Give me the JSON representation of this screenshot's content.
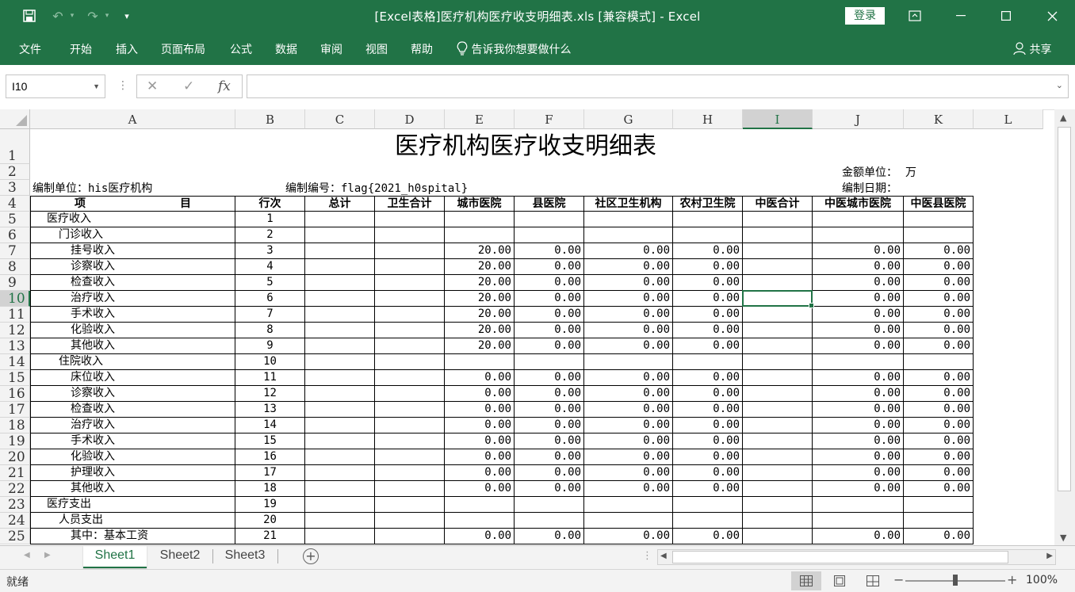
{
  "window": {
    "title": "[Excel表格]医疗机构医疗收支明细表.xls  [兼容模式]  -  Excel",
    "login_label": "登录",
    "minimize": "—",
    "restore": "☐",
    "close": "✕",
    "ribbon_toggle": "⊡"
  },
  "quick_access": {
    "save": "🖫",
    "undo": "↶",
    "redo": "↷",
    "customize": "▾"
  },
  "menu": {
    "items": [
      "文件",
      "开始",
      "插入",
      "页面布局",
      "公式",
      "数据",
      "审阅",
      "视图",
      "帮助"
    ],
    "tell_me": "告诉我你想要做什么",
    "share": "共享"
  },
  "formula_bar": {
    "name_box": "I10",
    "cancel": "✕",
    "enter": "✓",
    "fx": "fx",
    "formula": ""
  },
  "columns": [
    "A",
    "B",
    "C",
    "D",
    "E",
    "F",
    "G",
    "H",
    "I",
    "J",
    "K",
    "L"
  ],
  "selected_column": "I",
  "rows": [
    "1",
    "2",
    "3",
    "4",
    "5",
    "6",
    "7",
    "8",
    "9",
    "10",
    "11",
    "12",
    "13",
    "14",
    "15",
    "16",
    "17",
    "18",
    "19",
    "20",
    "21",
    "22",
    "23",
    "24",
    "25"
  ],
  "selected_row": "10",
  "sheet": {
    "title": "医疗机构医疗收支明细表",
    "amount_unit_label": "金额单位：",
    "amount_unit_value": "万",
    "unit_label": "编制单位：his医疗机构",
    "code_label": "编制编号：flag{2021_h0spital}",
    "date_label": "编制日期：",
    "header": {
      "item_left": "项",
      "item_right": "目",
      "row_no": "行次",
      "total": "总计",
      "health_total": "卫生合计",
      "city_hospital": "城市医院",
      "county_hospital": "县医院",
      "community": "社区卫生机构",
      "rural": "农村卫生院",
      "tcm_total": "中医合计",
      "tcm_city": "中医城市医院",
      "tcm_county": "中医县医院"
    },
    "data_rows": [
      {
        "item": "医疗收入",
        "indent": 1,
        "no": "1",
        "E": "",
        "F": "",
        "G": "",
        "H": "",
        "J": "",
        "K": ""
      },
      {
        "item": "门诊收入",
        "indent": 2,
        "no": "2",
        "E": "",
        "F": "",
        "G": "",
        "H": "",
        "J": "",
        "K": ""
      },
      {
        "item": "挂号收入",
        "indent": 3,
        "no": "3",
        "E": "20.00",
        "F": "0.00",
        "G": "0.00",
        "H": "0.00",
        "J": "0.00",
        "K": "0.00"
      },
      {
        "item": "诊察收入",
        "indent": 3,
        "no": "4",
        "E": "20.00",
        "F": "0.00",
        "G": "0.00",
        "H": "0.00",
        "J": "0.00",
        "K": "0.00"
      },
      {
        "item": "检查收入",
        "indent": 3,
        "no": "5",
        "E": "20.00",
        "F": "0.00",
        "G": "0.00",
        "H": "0.00",
        "J": "0.00",
        "K": "0.00"
      },
      {
        "item": "治疗收入",
        "indent": 3,
        "no": "6",
        "E": "20.00",
        "F": "0.00",
        "G": "0.00",
        "H": "0.00",
        "J": "0.00",
        "K": "0.00"
      },
      {
        "item": "手术收入",
        "indent": 3,
        "no": "7",
        "E": "20.00",
        "F": "0.00",
        "G": "0.00",
        "H": "0.00",
        "J": "0.00",
        "K": "0.00"
      },
      {
        "item": "化验收入",
        "indent": 3,
        "no": "8",
        "E": "20.00",
        "F": "0.00",
        "G": "0.00",
        "H": "0.00",
        "J": "0.00",
        "K": "0.00"
      },
      {
        "item": "其他收入",
        "indent": 3,
        "no": "9",
        "E": "20.00",
        "F": "0.00",
        "G": "0.00",
        "H": "0.00",
        "J": "0.00",
        "K": "0.00"
      },
      {
        "item": "住院收入",
        "indent": 2,
        "no": "10",
        "E": "",
        "F": "",
        "G": "",
        "H": "",
        "J": "",
        "K": ""
      },
      {
        "item": "床位收入",
        "indent": 3,
        "no": "11",
        "E": "0.00",
        "F": "0.00",
        "G": "0.00",
        "H": "0.00",
        "J": "0.00",
        "K": "0.00"
      },
      {
        "item": "诊察收入",
        "indent": 3,
        "no": "12",
        "E": "0.00",
        "F": "0.00",
        "G": "0.00",
        "H": "0.00",
        "J": "0.00",
        "K": "0.00"
      },
      {
        "item": "检查收入",
        "indent": 3,
        "no": "13",
        "E": "0.00",
        "F": "0.00",
        "G": "0.00",
        "H": "0.00",
        "J": "0.00",
        "K": "0.00"
      },
      {
        "item": "治疗收入",
        "indent": 3,
        "no": "14",
        "E": "0.00",
        "F": "0.00",
        "G": "0.00",
        "H": "0.00",
        "J": "0.00",
        "K": "0.00"
      },
      {
        "item": "手术收入",
        "indent": 3,
        "no": "15",
        "E": "0.00",
        "F": "0.00",
        "G": "0.00",
        "H": "0.00",
        "J": "0.00",
        "K": "0.00"
      },
      {
        "item": "化验收入",
        "indent": 3,
        "no": "16",
        "E": "0.00",
        "F": "0.00",
        "G": "0.00",
        "H": "0.00",
        "J": "0.00",
        "K": "0.00"
      },
      {
        "item": "护理收入",
        "indent": 3,
        "no": "17",
        "E": "0.00",
        "F": "0.00",
        "G": "0.00",
        "H": "0.00",
        "J": "0.00",
        "K": "0.00"
      },
      {
        "item": "其他收入",
        "indent": 3,
        "no": "18",
        "E": "0.00",
        "F": "0.00",
        "G": "0.00",
        "H": "0.00",
        "J": "0.00",
        "K": "0.00"
      },
      {
        "item": "医疗支出",
        "indent": 1,
        "no": "19",
        "E": "",
        "F": "",
        "G": "",
        "H": "",
        "J": "",
        "K": ""
      },
      {
        "item": "人员支出",
        "indent": 2,
        "no": "20",
        "E": "",
        "F": "",
        "G": "",
        "H": "",
        "J": "",
        "K": ""
      },
      {
        "item": "其中：基本工资",
        "indent": 3,
        "no": "21",
        "E": "0.00",
        "F": "0.00",
        "G": "0.00",
        "H": "0.00",
        "J": "0.00",
        "K": "0.00"
      }
    ]
  },
  "tabs": [
    "Sheet1",
    "Sheet2",
    "Sheet3"
  ],
  "active_tab": "Sheet1",
  "add_sheet": "+",
  "status": {
    "ready": "就绪",
    "zoom": "100%",
    "zoom_out": "−",
    "zoom_in": "+"
  },
  "colors": {
    "excel_green": "#217346",
    "header_bg": "#f3f3f3",
    "selected_header_bg": "#d2d2d2"
  }
}
